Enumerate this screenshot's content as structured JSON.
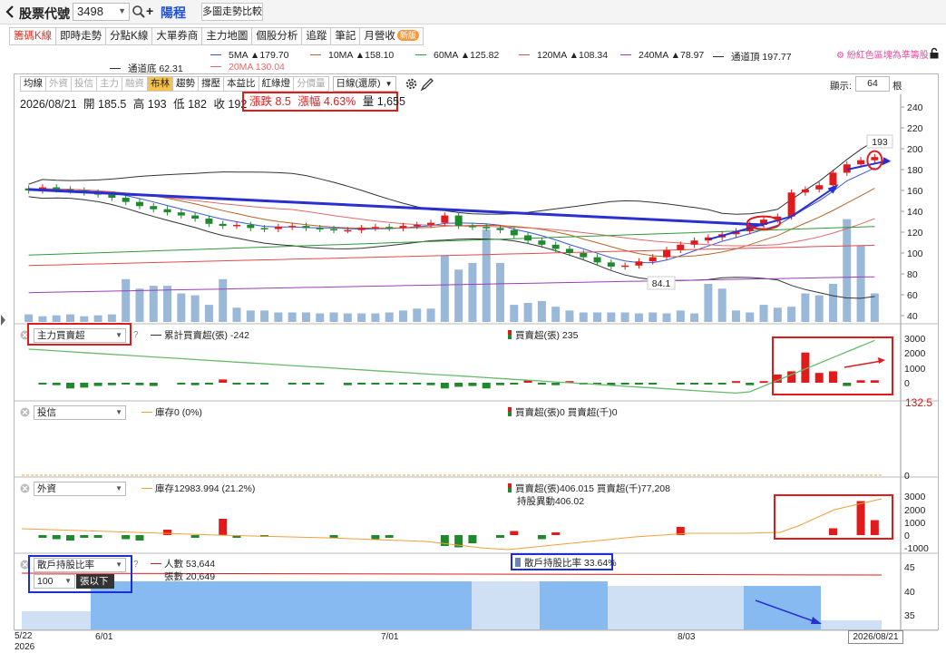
{
  "header": {
    "stock_label": "股票代號",
    "stock_code": "3498",
    "stock_name": "陽程",
    "compare_button": "多圖走勢比較"
  },
  "tabs": [
    {
      "label": "籌碼K線",
      "active": true
    },
    {
      "label": "即時走勢"
    },
    {
      "label": "分點K線"
    },
    {
      "label": "大單券商"
    },
    {
      "label": "主力地圖"
    },
    {
      "label": "個股分析"
    },
    {
      "label": "追蹤"
    },
    {
      "label": "筆記"
    },
    {
      "label": "月營收",
      "badge": "新版"
    }
  ],
  "ma_color_link": "紛紅色區塊為準籌股",
  "ma_legend": [
    {
      "label": "5MA ▲179.70",
      "color": "#3b55d9"
    },
    {
      "label": "10MA ▲158.10",
      "color": "#b8662a"
    },
    {
      "label": "60MA ▲125.82",
      "color": "#2f9a3b"
    },
    {
      "label": "120MA ▲108.34",
      "color": "#e24b4b"
    },
    {
      "label": "240MA ▲78.97",
      "color": "#9a3fb8"
    },
    {
      "label": "通道頂 197.77",
      "color": "#333333"
    },
    {
      "label": "通道底 62.31",
      "color": "#333333"
    },
    {
      "label": "20MA 130.04",
      "color": "#e06a6a"
    }
  ],
  "indicator_buttons": [
    {
      "label": "均線",
      "dim": false
    },
    {
      "label": "外資",
      "dim": true
    },
    {
      "label": "投信",
      "dim": true
    },
    {
      "label": "主力",
      "dim": true
    },
    {
      "label": "融資",
      "dim": true
    },
    {
      "label": "布林",
      "dim": false,
      "selected": true
    },
    {
      "label": "趨勢",
      "dim": false
    },
    {
      "label": "撐壓",
      "dim": false
    },
    {
      "label": "本益比",
      "dim": false
    },
    {
      "label": "紅綠燈",
      "dim": false
    },
    {
      "label": "分價量",
      "dim": true
    }
  ],
  "period_select": "日線(還原)",
  "display": {
    "label": "顯示:",
    "value": "64",
    "unit": "根"
  },
  "ohlc": {
    "date": "2026/08/21",
    "open": "開 185.5",
    "high": "高 193",
    "low": "低 182",
    "close": "收 192"
  },
  "change": {
    "chg": "漲跌 8.5",
    "pct": "漲幅 4.63%",
    "vol": "量 1,655"
  },
  "price_axis": [
    "240",
    "220",
    "200",
    "180",
    "160",
    "140",
    "120",
    "100",
    "80",
    "60",
    "40"
  ],
  "annotations": {
    "high_mark": "193",
    "low_mark": "84.1"
  },
  "chart_data": {
    "type": "candlestick",
    "price_range": [
      30,
      250
    ],
    "dates": {
      "first": "5/22",
      "year": "2026",
      "ticks": [
        "6/01",
        "7/01",
        "8/03"
      ],
      "last": "2026/08/21"
    },
    "closes": [
      160,
      163,
      161,
      160,
      158,
      156,
      153,
      149,
      145,
      142,
      139,
      136,
      133,
      128,
      126,
      127,
      124,
      123,
      125,
      126,
      124,
      123,
      122,
      122,
      124,
      125,
      124,
      126,
      127,
      129,
      136,
      126,
      125,
      124,
      122,
      117,
      112,
      108,
      104,
      100,
      96,
      91,
      87,
      88,
      92,
      96,
      103,
      108,
      112,
      115,
      118,
      121,
      127,
      132,
      135,
      158,
      161,
      165,
      177,
      185,
      189,
      192
    ],
    "volume_relative": [
      8,
      6,
      7,
      8,
      6,
      7,
      8,
      45,
      35,
      38,
      38,
      30,
      28,
      18,
      45,
      15,
      12,
      12,
      10,
      10,
      10,
      9,
      10,
      9,
      9,
      9,
      10,
      12,
      14,
      14,
      70,
      55,
      62,
      97,
      62,
      18,
      20,
      22,
      16,
      12,
      10,
      10,
      10,
      10,
      9,
      10,
      9,
      12,
      9,
      40,
      35,
      12,
      10,
      18,
      15,
      16,
      30,
      28,
      40,
      108,
      80,
      30,
      18,
      15
    ]
  },
  "panels": {
    "main_force": {
      "select": "主力買賣超",
      "legend_line": "累計買賣超(張) -242",
      "legend_bar": "買賣超(張) 235",
      "axis": [
        "3000",
        "2000",
        "1000",
        "0"
      ]
    },
    "investment_trust": {
      "select": "投信",
      "legend_line": "庫存0 (0%)",
      "legend_bar": "買賣超(張)0 買賣超(千)0",
      "top_value": "132.5",
      "axis": [
        "0"
      ]
    },
    "foreign": {
      "select": "外資",
      "legend_line": "庫存12983.994 (21.2%)",
      "legend_bar": "買賣超(張)406.015 買賣超(千)77,208",
      "legend_sub": "持股異動406.02",
      "axis": [
        "3000",
        "2000",
        "1000",
        "0",
        "-1000"
      ]
    },
    "holders": {
      "select": "散戶持股比率",
      "legend_line": "人數 53,644",
      "legend_sub": "張數 20,649",
      "legend_ratio": "散戶持股比率 33.64%",
      "threshold_value": "100",
      "threshold_label": "張以下",
      "axis": [
        "45",
        "40",
        "35"
      ]
    }
  }
}
